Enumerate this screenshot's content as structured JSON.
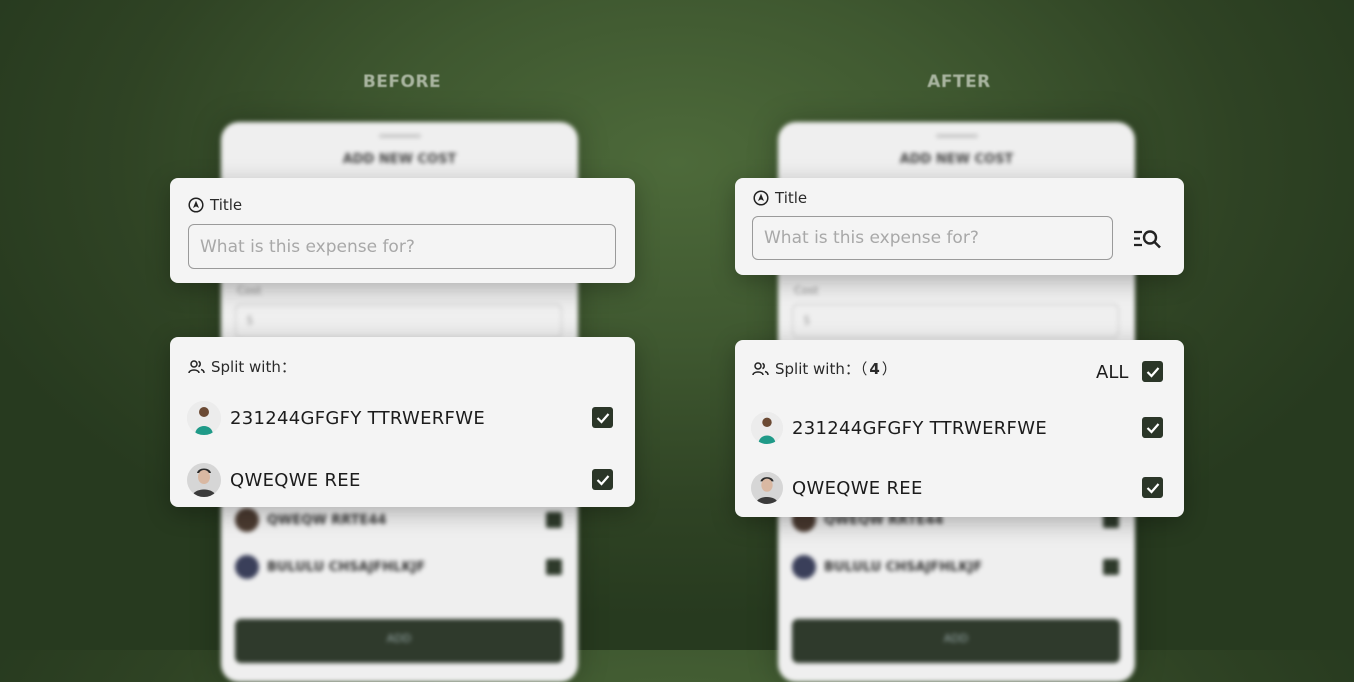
{
  "before": {
    "heading": "BEFORE",
    "title_card": {
      "label": "Title",
      "placeholder": "What is this expense for?"
    },
    "split_card": {
      "label": "Split with：",
      "members": [
        {
          "name": "231244GFGFY TTRWERFWE",
          "checked": true,
          "avatar": "person-green-jersey"
        },
        {
          "name": "QWEQWE REE",
          "checked": true,
          "avatar": "person-portrait"
        }
      ]
    },
    "phone": {
      "title": "ADD NEW COST",
      "cost_label": "Cost",
      "cost_placeholder": "$",
      "rows": [
        "QWEQW RRTE44",
        "BULULU CHSAJFHLKJF"
      ],
      "button": "ADD"
    }
  },
  "after": {
    "heading": "AFTER",
    "title_card": {
      "label": "Title",
      "placeholder": "What is this expense for?",
      "action_icon": "list-search-icon"
    },
    "split_card": {
      "label": "Split with：（",
      "count": "4",
      "count_close": "）",
      "all_label": "ALL",
      "all_checked": true,
      "members": [
        {
          "name": "231244GFGFY TTRWERFWE",
          "checked": true,
          "avatar": "person-green-jersey"
        },
        {
          "name": "QWEQWE REE",
          "checked": true,
          "avatar": "person-portrait"
        }
      ]
    },
    "phone": {
      "title": "ADD NEW COST",
      "cost_label": "Cost",
      "cost_placeholder": "$",
      "rows": [
        "QWEQW RRTE44",
        "BULULU CHSAJFHLKJF"
      ],
      "button": "ADD"
    }
  },
  "colors": {
    "background": "#3f5830",
    "card": "#f4f4f4",
    "checkbox": "#2b3628",
    "heading": "#a9b5a0"
  }
}
